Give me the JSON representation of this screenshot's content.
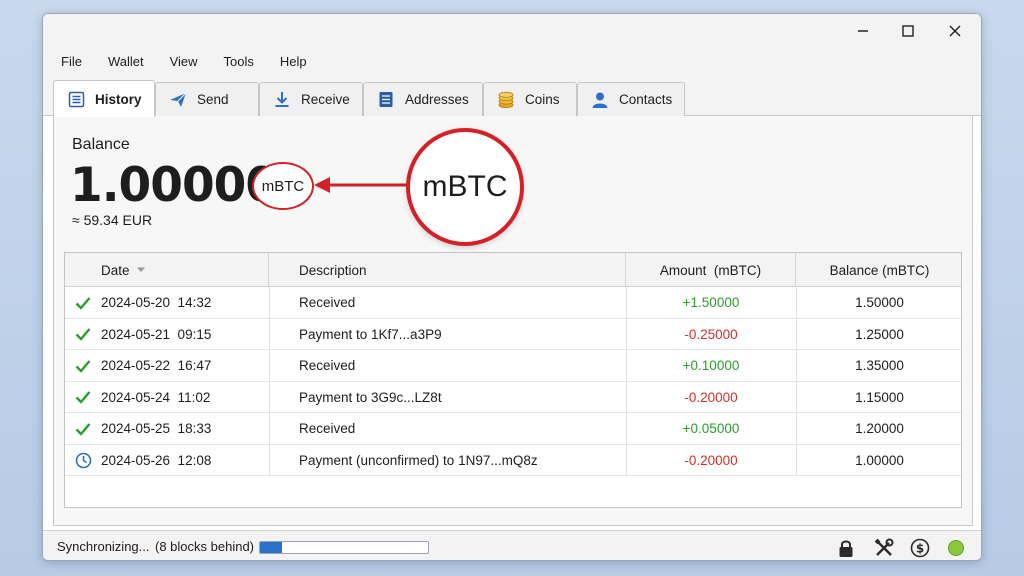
{
  "menu": [
    "File",
    "Wallet",
    "View",
    "Tools",
    "Help"
  ],
  "tabs": [
    {
      "label": "History",
      "icon": "history-icon",
      "active": true
    },
    {
      "label": "Send",
      "icon": "send-icon",
      "active": false
    },
    {
      "label": "Receive",
      "icon": "receive-icon",
      "active": false
    },
    {
      "label": "Addresses",
      "icon": "addresses-icon",
      "active": false
    },
    {
      "label": "Coins",
      "icon": "coins-icon",
      "active": false
    },
    {
      "label": "Contacts",
      "icon": "contacts-icon",
      "active": false
    }
  ],
  "balance": {
    "label": "Balance",
    "value": "1.00000",
    "unit": "mBTC",
    "fiat": "≈ 59.34 EUR",
    "callout": "mBTC"
  },
  "table": {
    "columns": [
      "Date",
      "Description",
      "Amount  (mBTC)",
      "Balance (mBTC)"
    ],
    "sort_indicator": "chevron-down-icon",
    "rows": [
      {
        "status": "confirmed",
        "date": "2024-05-20  14:32",
        "description": "Received",
        "amount": "+1.50000",
        "balance": "1.50000"
      },
      {
        "status": "confirmed",
        "date": "2024-05-21  09:15",
        "description": "Payment to 1Kf7...a3P9",
        "amount": "-0.25000",
        "balance": "1.25000"
      },
      {
        "status": "confirmed",
        "date": "2024-05-22  16:47",
        "description": "Received",
        "amount": "+0.10000",
        "balance": "1.35000"
      },
      {
        "status": "confirmed",
        "date": "2024-05-24  11:02",
        "description": "Payment to 3G9c...LZ8t",
        "amount": "-0.20000",
        "balance": "1.15000"
      },
      {
        "status": "confirmed",
        "date": "2024-05-25  18:33",
        "description": "Received",
        "amount": "+0.05000",
        "balance": "1.20000"
      },
      {
        "status": "unconfirmed",
        "date": "2024-05-26  12:08",
        "description": "Payment (unconfirmed) to 1N97...mQ8z",
        "amount": "-0.20000",
        "balance": "1.00000"
      }
    ]
  },
  "status": {
    "text": "Synchronizing...",
    "detail": "(8 blocks behind)",
    "progress_fraction": 0.13,
    "icons": [
      "lock-icon",
      "tools-icon",
      "currency-icon",
      "network-status-icon"
    ]
  },
  "colors": {
    "accent": "#2a71c9",
    "positive": "#2a9d2a",
    "negative": "#d0302b",
    "highlight": "#d42027",
    "online": "#8cc63f"
  }
}
